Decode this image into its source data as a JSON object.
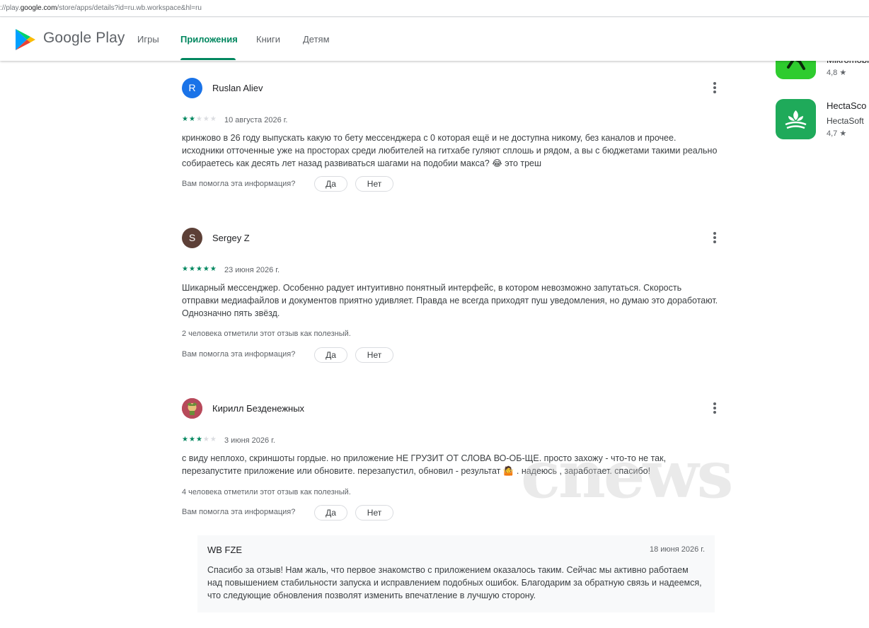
{
  "browser": {
    "url_prefix": "://play.",
    "url_domain": "google.com",
    "url_suffix": "/store/apps/details?id=ru.wb.workspace&hl=ru"
  },
  "header": {
    "brand": "Google Play",
    "nav": [
      {
        "label": "Игры",
        "active": false
      },
      {
        "label": "Приложения",
        "active": true
      },
      {
        "label": "Книги",
        "active": false
      },
      {
        "label": "Детям",
        "active": false
      }
    ]
  },
  "reviews": [
    {
      "author": "Ruslan Aliev",
      "avatar_letter": "R",
      "avatar_color": "#1a73e8",
      "rating": 2,
      "date": "10 августа 2026 г.",
      "text": "кринжово в 26 году выпускать какую то бету мессенджера с 0 которая ещё и не доступна никому, без каналов и прочее. исходники отточенные уже на просторах среди любителей на гитхабе гуляют сплошь и рядом, а вы с бюджетами такими реально собираетесь как десять лет назад развиваться шагами на подобии макса? 😂 это треш",
      "helpful_count_text": "",
      "helpful_question": "Вам помогла эта информация?",
      "yes": "Да",
      "no": "Нет"
    },
    {
      "author": "Sergey Z",
      "avatar_letter": "S",
      "avatar_color": "#5d4037",
      "rating": 5,
      "date": "23 июня 2026 г.",
      "text": "Шикарный мессенджер. Особенно радует интуитивно понятный интерфейс, в котором невозможно запутаться. Скорость отправки медиафайлов и документов приятно удивляет. Правда не всегда приходят пуш уведомления, но думаю это доработают. Однозначно пять звёзд.",
      "helpful_count_text": "2 человека отметили этот отзыв как полезный.",
      "helpful_question": "Вам помогла эта информация?",
      "yes": "Да",
      "no": "Нет"
    },
    {
      "author": "Кирилл Безденежных",
      "avatar_letter": "",
      "avatar_color": "#c2185b",
      "rating": 3,
      "date": "3 июня 2026 г.",
      "text": "с виду неплохо, скриншоты гордые. но приложение НЕ ГРУЗИТ ОТ СЛОВА ВО-ОБ-ЩЕ. просто захожу - что-то не так, перезапустите приложение или обновите. перезапустил, обновил - результат 🤷 . надеюсь , заработает. спасибо!",
      "helpful_count_text": "4 человека отметили этот отзыв как полезный.",
      "helpful_question": "Вам помогла эта информация?",
      "yes": "Да",
      "no": "Нет"
    }
  ],
  "developer_reply": {
    "name": "WB FZE",
    "date": "18 июня 2026 г.",
    "text": "Спасибо за отзыв! Нам жаль, что первое знакомство с приложением оказалось таким. Сейчас мы активно работаем над повышением стабильности запуска и исправлением подобных ошибок. Благодарим за обратную связь и надеемся, что следующие обновления позволят изменить впечатление в лучшую сторону."
  },
  "similar_apps": [
    {
      "title": "Mikromobi",
      "developer": "",
      "rating": "4,8 ★",
      "icon_color": "#2ecc2e"
    },
    {
      "title": "HectaSco",
      "developer": "HectaSoft",
      "rating": "4,7 ★",
      "icon_color": "#1faa5a"
    }
  ],
  "watermark": "cnews",
  "colors": {
    "accent": "#01875f",
    "star_off": "#dadce0"
  }
}
